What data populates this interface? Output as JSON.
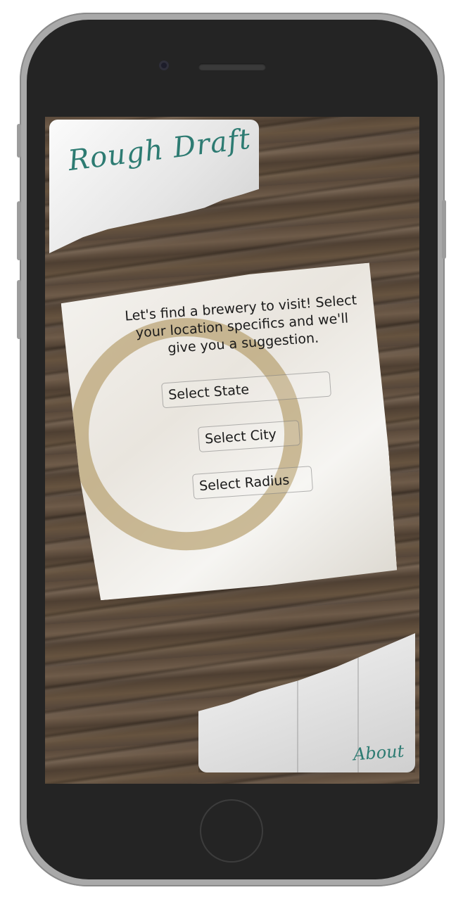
{
  "app": {
    "title": "Rough Draft"
  },
  "intro": {
    "text": "Let's find a brewery to visit! Select your location specifics and we'll give you a suggestion."
  },
  "form": {
    "state_label": "Select State",
    "city_label": "Select City",
    "radius_label": "Select Radius"
  },
  "footer": {
    "about_label": "About"
  },
  "colors": {
    "accent": "#2d7b72",
    "wood": "#5c4b3c",
    "stain": "#b09660"
  }
}
